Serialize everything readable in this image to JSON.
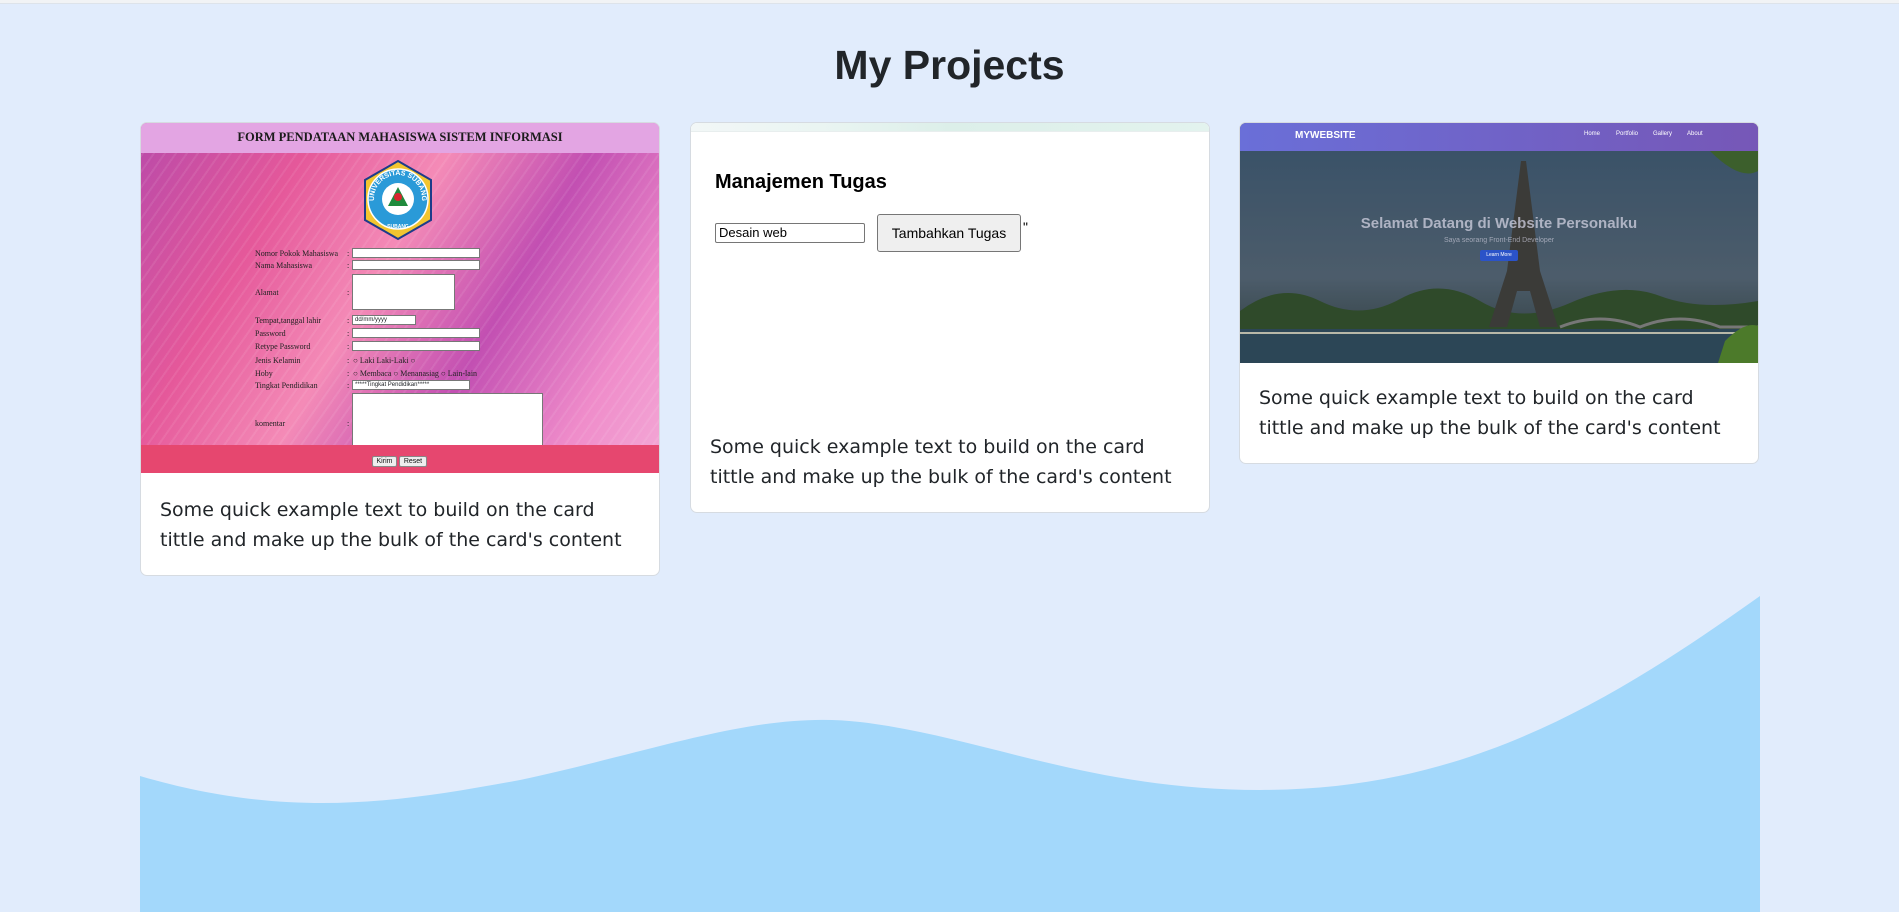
{
  "section": {
    "title": "My Projects"
  },
  "cards": [
    {
      "text": "Some quick example text to build on the card tittle and make up the bulk of the card's content",
      "screenshot": {
        "header": "FORM PENDATAAN MAHASISWA SISTEM INFORMASI",
        "logo_text": "UNIVERSITAS SUBANG",
        "logo_bottom": "SUBANG",
        "fields": {
          "npm": "Nomor Pokok Mahasiswa",
          "nama": "Nama Mahasiswa",
          "alamat": "Alamat",
          "ttl": "Tempat,tanggal lahir",
          "date_placeholder": "dd/mm/yyyy",
          "password": "Password",
          "retype": "Retype Password",
          "gender": "Jenis Kelamin",
          "gender_opt1": "Laki Laki-Laki",
          "hobby": "Hoby",
          "hobby_opt1": "Membaca",
          "hobby_opt2": "Menanasiag",
          "hobby_opt3": "Lain-lain",
          "edu": "Tingkat Pendidikan",
          "edu_select": "*****Tingkat Pendidikan*****",
          "comment": "komentar"
        },
        "submit": "Kirim",
        "reset": "Reset"
      }
    },
    {
      "text": "Some quick example text to build on the card tittle and make up the bulk of the card's content",
      "screenshot": {
        "title": "Manajemen Tugas",
        "input_value": "Desain web",
        "button": "Tambahkan Tugas",
        "stray": "\""
      }
    },
    {
      "text": "Some quick example text to build on the card tittle and make up the bulk of the card's content",
      "screenshot": {
        "brand": "MYWEBSITE",
        "nav": [
          "Home",
          "Portfolio",
          "Gallery",
          "About"
        ],
        "hero_title": "Selamat Datang di Website Personalku",
        "hero_sub": "Saya seorang Front-End Developer",
        "hero_button": "Learn More"
      }
    }
  ],
  "colors": {
    "background": "#e1ecfc",
    "wave": "#a3d8fb"
  }
}
